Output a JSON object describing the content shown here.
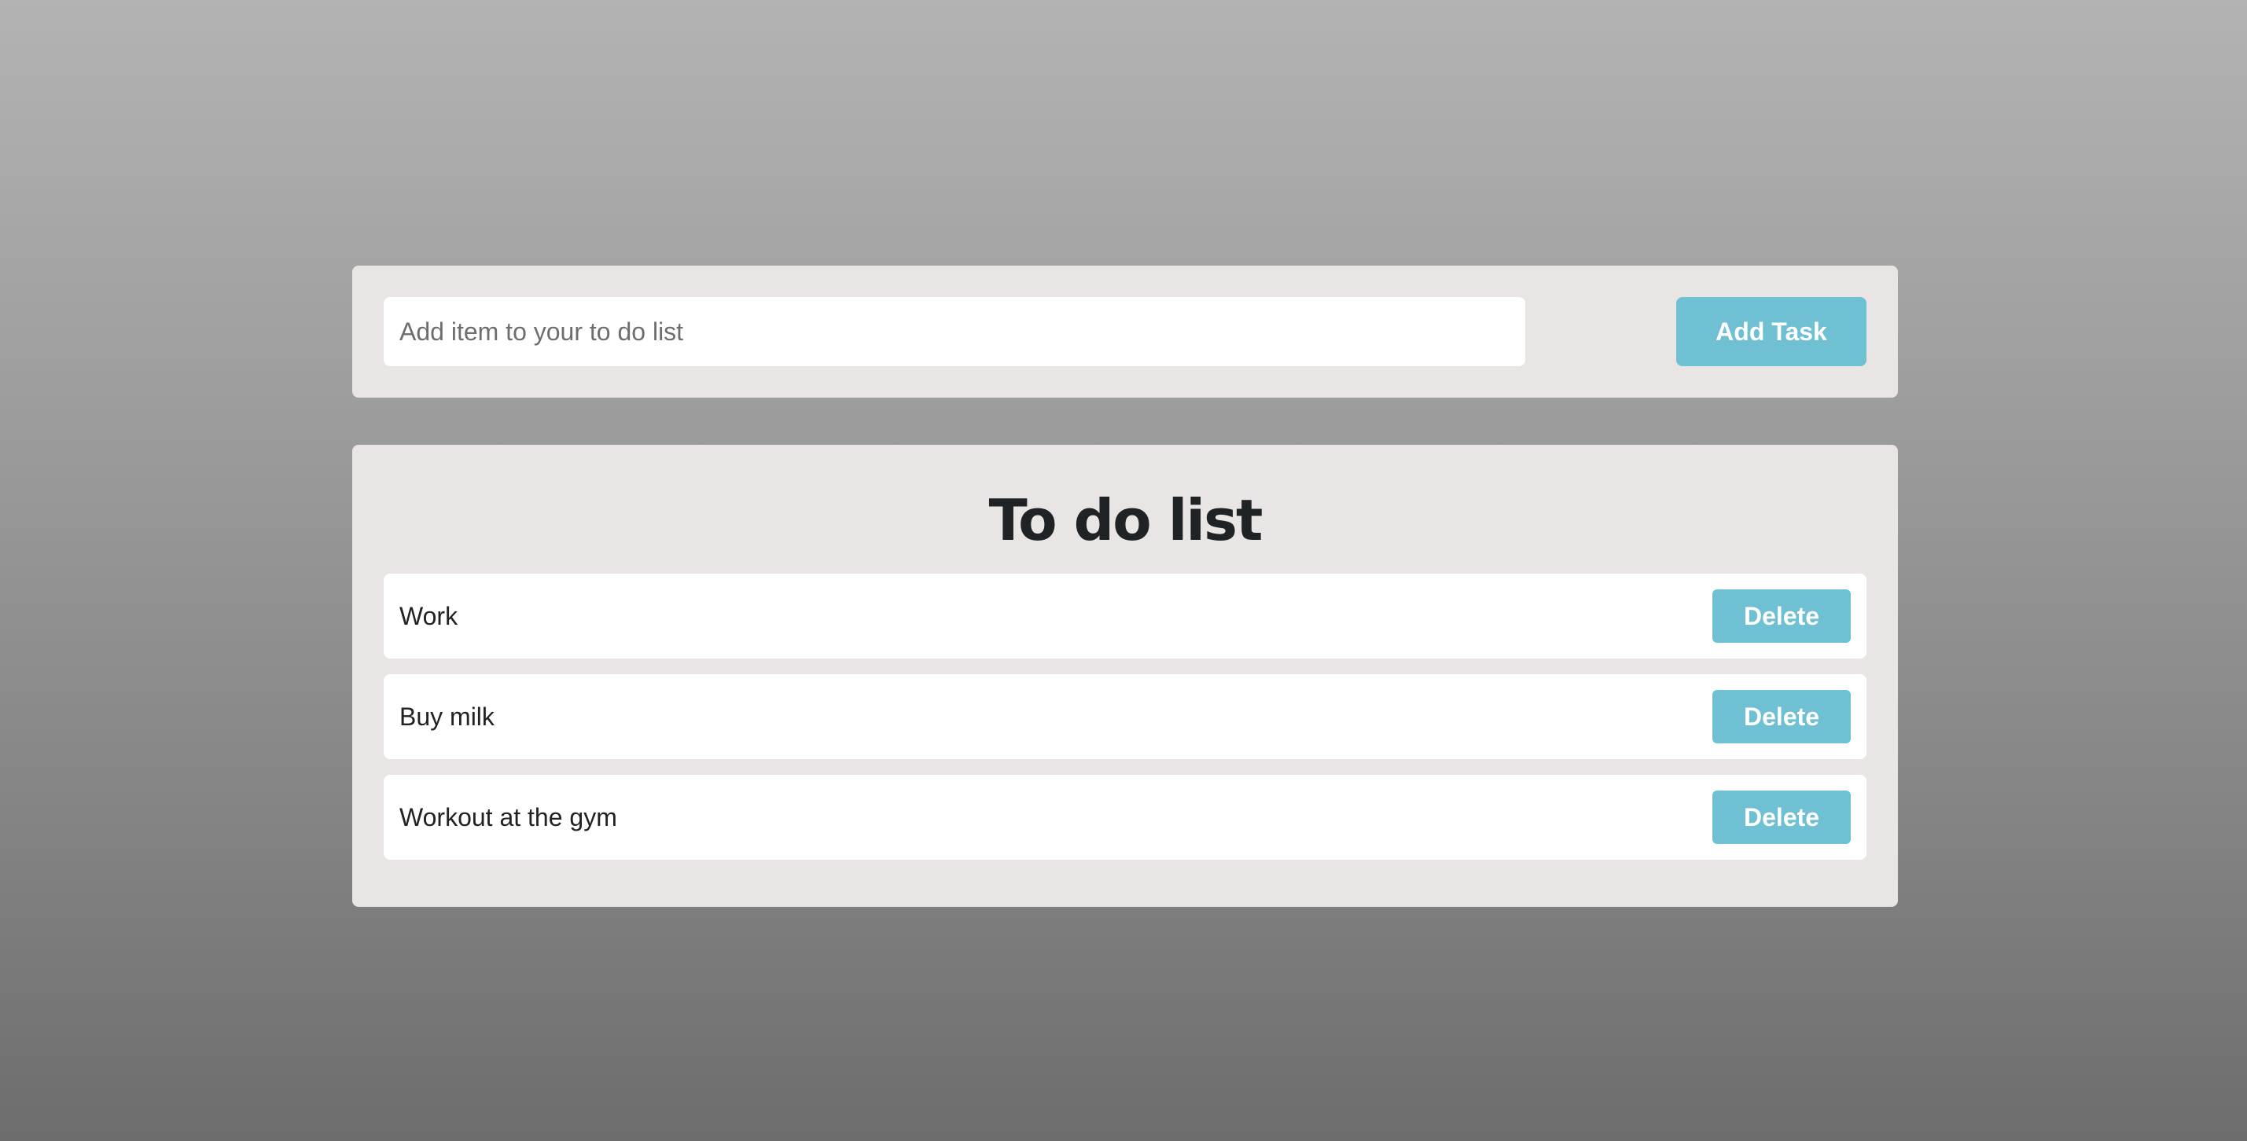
{
  "input_panel": {
    "placeholder": "Add item to your to do list",
    "value": "",
    "add_button_label": "Add Task"
  },
  "list_panel": {
    "title": "To do list",
    "items": [
      {
        "text": "Work",
        "delete_label": "Delete"
      },
      {
        "text": "Buy milk",
        "delete_label": "Delete"
      },
      {
        "text": "Workout at the gym",
        "delete_label": "Delete"
      }
    ]
  },
  "colors": {
    "accent": "#6fc0d2",
    "panel_background": "#e8e5e4",
    "item_background": "#ffffff",
    "title_text": "#1f2326"
  }
}
